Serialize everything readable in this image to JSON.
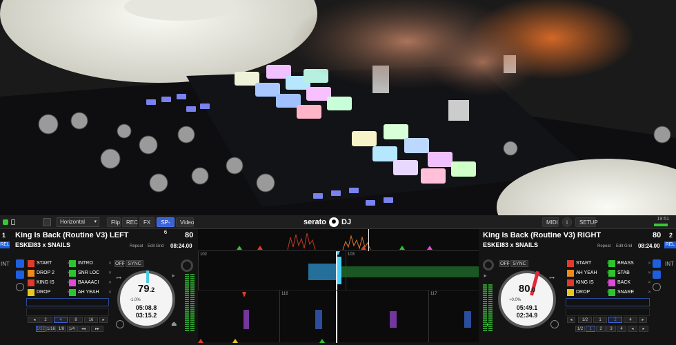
{
  "topbar": {
    "layout_value": "Horizontal",
    "buttons": [
      "Flip",
      "REC",
      "FX",
      "SP-6",
      "Video"
    ],
    "active_button": "SP-6",
    "brand": "serato",
    "brand_suffix": "DJ",
    "right_buttons": [
      "MIDI",
      "SETUP"
    ],
    "time": "19:51"
  },
  "deck_left": {
    "number": "1",
    "title": "King Is Back (Routine V3) LEFT",
    "artist": "ESKEI83 x SNAILS",
    "bpm": "80",
    "repeat": "Repeat",
    "edit_grid": "Edit Grid",
    "length": "08:24.00",
    "rel": "REL",
    "int": "INT",
    "off": "OFF",
    "sync": "SYNC",
    "platter_bpm": "79",
    "platter_bpm_dec": ".2",
    "pitch_pct": "-1.0%",
    "elapsed": "05:08.8",
    "remaining": "03:15.2",
    "cues": [
      {
        "label": "START",
        "color": "#e03a2a"
      },
      {
        "label": "DROP 2",
        "color": "#f08a1a"
      },
      {
        "label": "KING IS",
        "color": "#e03a2a"
      },
      {
        "label": "DROP",
        "color": "#e8c81a"
      },
      {
        "label": "INTRO",
        "color": "#2ec42e"
      },
      {
        "label": "SNR LOC",
        "color": "#2ec42e"
      },
      {
        "label": "BAAAACI",
        "color": "#e04ad8"
      },
      {
        "label": "AH YEAH",
        "color": "#2ec42e"
      }
    ],
    "loops_row1": [
      "2",
      "4",
      "8",
      "16"
    ],
    "loops_row2": [
      "1/32",
      "1/16",
      "1/8",
      "1/4"
    ]
  },
  "deck_right": {
    "number": "2",
    "title": "King Is Back (Routine V3) RIGHT",
    "artist": "ESKEI83 x SNAILS",
    "bpm": "80",
    "repeat": "Repeat",
    "edit_grid": "Edit Grid",
    "length": "08:24.00",
    "rel": "REL",
    "int": "INT",
    "off": "OFF",
    "sync": "SYNC",
    "platter_bpm": "80",
    "platter_bpm_dec": ".0",
    "pitch_pct": "+0.0%",
    "elapsed": "05:49.1",
    "remaining": "02:34.9",
    "cues": [
      {
        "label": "START",
        "color": "#e03a2a"
      },
      {
        "label": "AH YEAH",
        "color": "#f08a1a"
      },
      {
        "label": "KING IS",
        "color": "#e03a2a"
      },
      {
        "label": "DROP",
        "color": "#e8c81a"
      },
      {
        "label": "BRASS",
        "color": "#2ec42e"
      },
      {
        "label": "STAB",
        "color": "#2ec42e"
      },
      {
        "label": "BACK",
        "color": "#e04ad8"
      },
      {
        "label": "SNARE",
        "color": "#2ec42e"
      }
    ],
    "loops_row1": [
      "1/2",
      "1",
      "2",
      "4"
    ],
    "loops_row2": [
      "1/2",
      "1",
      "2",
      "3",
      "4"
    ]
  },
  "waveform": {
    "left_beats": [
      "102",
      "103"
    ],
    "right_beats": [
      "116",
      "117"
    ]
  }
}
